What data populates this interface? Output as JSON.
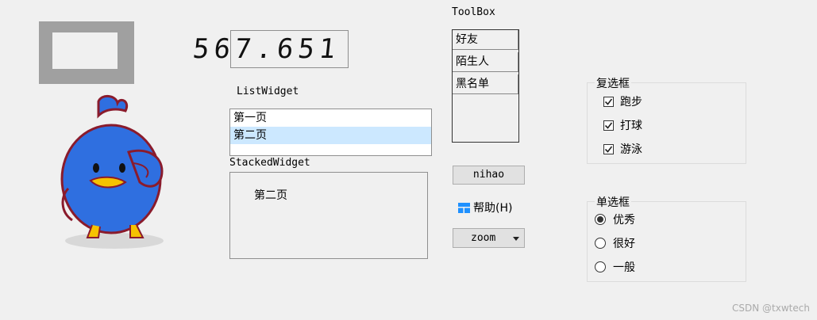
{
  "lcd": {
    "value": "567.651"
  },
  "labels": {
    "list_widget": "ListWidget",
    "stacked_widget": "StackedWidget",
    "toolbox": "ToolBox"
  },
  "list_widget": {
    "items": [
      {
        "label": "第一页",
        "selected": false
      },
      {
        "label": "第二页",
        "selected": true
      }
    ]
  },
  "stacked_widget": {
    "page_text": "第二页"
  },
  "toolbox": {
    "items": [
      {
        "label": "好友"
      },
      {
        "label": "陌生人"
      },
      {
        "label": "黑名单"
      }
    ]
  },
  "button": {
    "label": "nihao"
  },
  "help": {
    "label": "帮助(H)",
    "icon": "windows-icon"
  },
  "combo": {
    "value": "zoom"
  },
  "checkbox_group": {
    "title": "复选框",
    "items": [
      {
        "label": "跑步",
        "checked": true
      },
      {
        "label": "打球",
        "checked": true
      },
      {
        "label": "游泳",
        "checked": true
      }
    ]
  },
  "radio_group": {
    "title": "单选框",
    "items": [
      {
        "label": "优秀",
        "checked": true
      },
      {
        "label": "很好",
        "checked": false
      },
      {
        "label": "一般",
        "checked": false
      }
    ]
  },
  "watermark": "CSDN @txwtech",
  "mascot": {
    "icon": "blue-bird-icon"
  }
}
